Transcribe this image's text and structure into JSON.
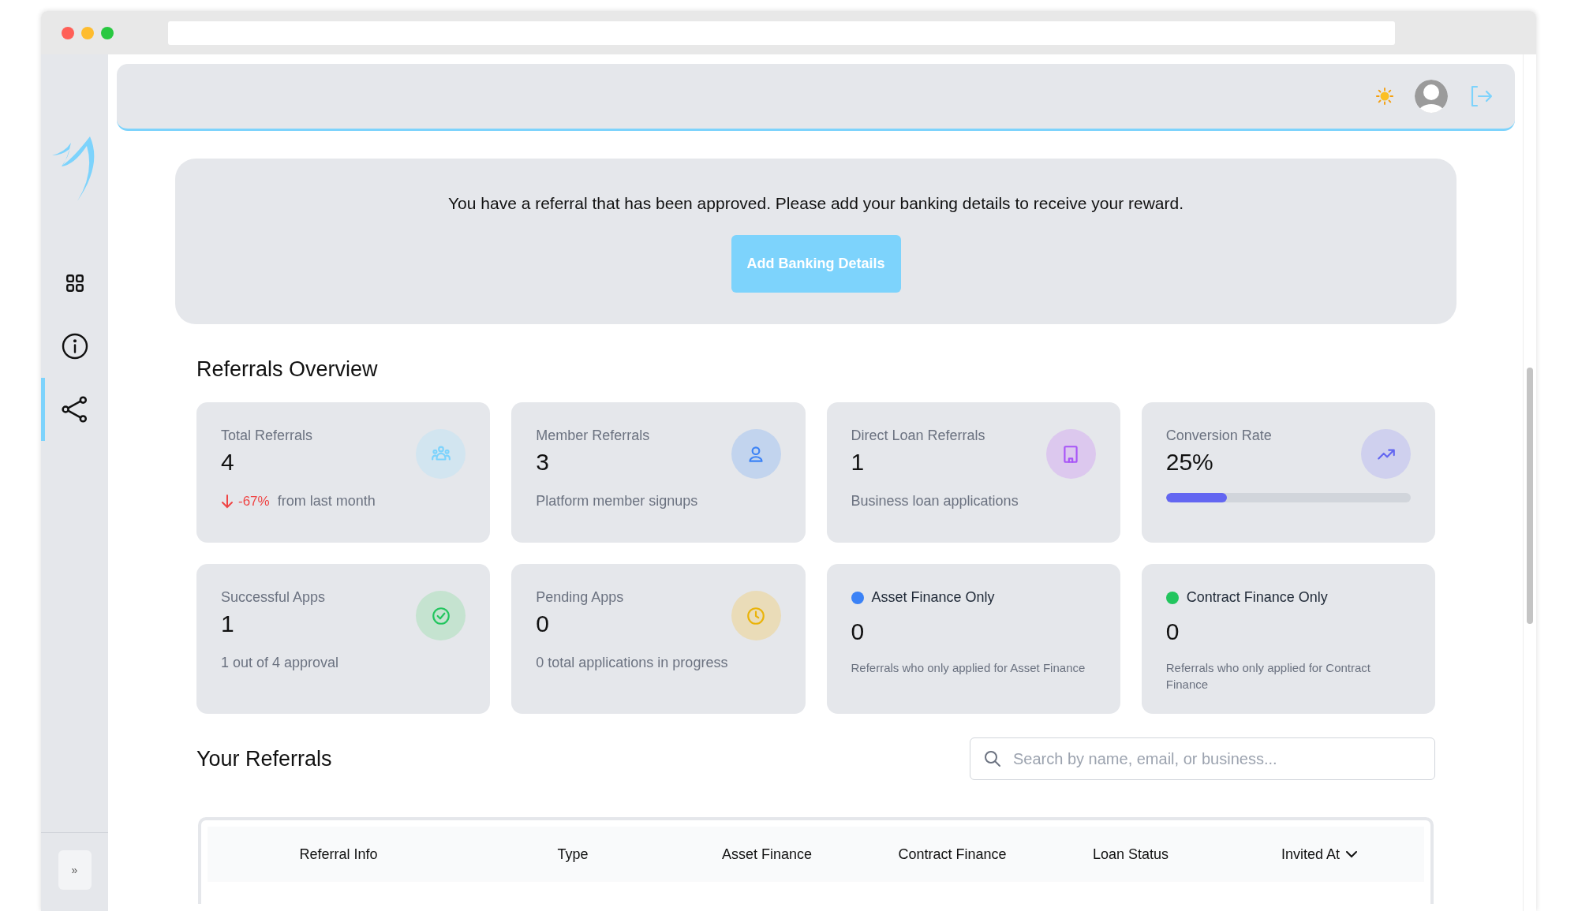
{
  "sidebar": {
    "items": [
      {
        "kind": "dashboard",
        "selected": false
      },
      {
        "kind": "info",
        "selected": false
      },
      {
        "kind": "share",
        "selected": true
      }
    ],
    "expand": "»"
  },
  "banner": {
    "message": "You have a referral that has been approved. Please add your banking details to receive your reward.",
    "button": "Add Banking Details"
  },
  "overview": {
    "title": "Referrals Overview",
    "cards": [
      {
        "kind": "stat",
        "label": "Total Referrals",
        "value": "4",
        "trend": {
          "change": "-67%",
          "note": "from last month"
        }
      },
      {
        "kind": "stat",
        "label": "Member Referrals",
        "value": "3",
        "note": "Platform member signups"
      },
      {
        "kind": "stat",
        "label": "Direct Loan Referrals",
        "value": "1",
        "note": "Business loan applications"
      },
      {
        "kind": "progress",
        "label": "Conversion Rate",
        "value": "25%",
        "level": 0.25
      },
      {
        "kind": "stat",
        "label": "Successful Apps",
        "value": "1",
        "note": "1 out of 4 approval"
      },
      {
        "kind": "stat",
        "label": "Pending Apps",
        "value": "0",
        "note": "0 total applications in progress"
      },
      {
        "kind": "dot",
        "label": "Asset Finance Only",
        "value": "0",
        "color": "#3b82f6",
        "note": "Referrals who only applied for Asset Finance"
      },
      {
        "kind": "dot",
        "label": "Contract Finance Only",
        "value": "0",
        "color": "#22c55e",
        "note": "Referrals who only applied for Contract Finance"
      }
    ]
  },
  "referrals": {
    "title": "Your Referrals",
    "search": {
      "placeholder": "Search by name, email, or business..."
    },
    "columns": [
      {
        "label": "Referral Info",
        "sortable": false
      },
      {
        "label": "Type",
        "sortable": false
      },
      {
        "label": "Asset Finance",
        "sortable": false
      },
      {
        "label": "Contract Finance",
        "sortable": false
      },
      {
        "label": "Loan Status",
        "sortable": false
      },
      {
        "label": "Invited At",
        "sortable": true
      }
    ]
  }
}
